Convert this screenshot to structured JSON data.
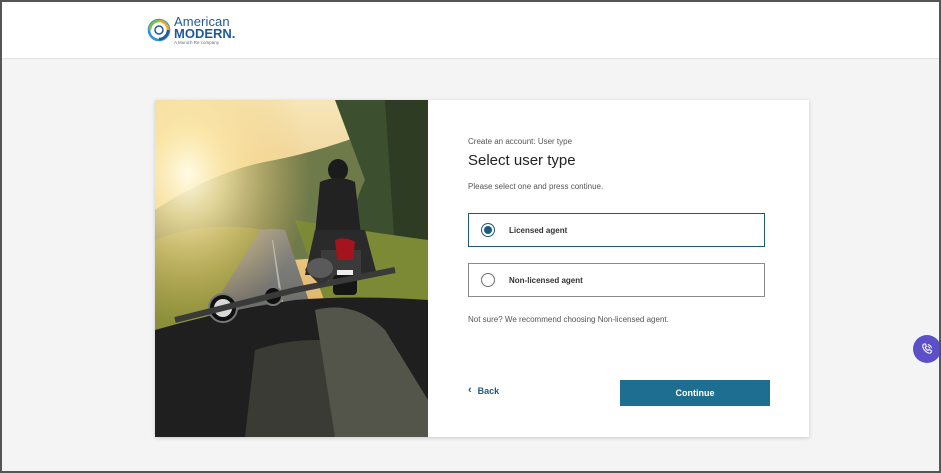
{
  "brand": {
    "line1": "American",
    "line2": "MODERN.",
    "line3": "A Munich Re company",
    "color": "#1e5a9a"
  },
  "form": {
    "breadcrumb": "Create an account: User type",
    "title": "Select user type",
    "subtitle": "Please select one and press continue.",
    "options": [
      {
        "label": "Licensed agent",
        "selected": true
      },
      {
        "label": "Non-licensed agent",
        "selected": false
      }
    ],
    "note": "Not sure? We recommend choosing Non-licensed agent.",
    "back_label": "Back",
    "back_icon": "chevron-left-icon",
    "continue_label": "Continue"
  },
  "colors": {
    "accent": "#1e5a7e",
    "button": "#1e6e91",
    "call_button": "#5d4ec9",
    "page_bg": "#f4f4f4"
  },
  "icons": {
    "call": "phone-call-icon"
  }
}
